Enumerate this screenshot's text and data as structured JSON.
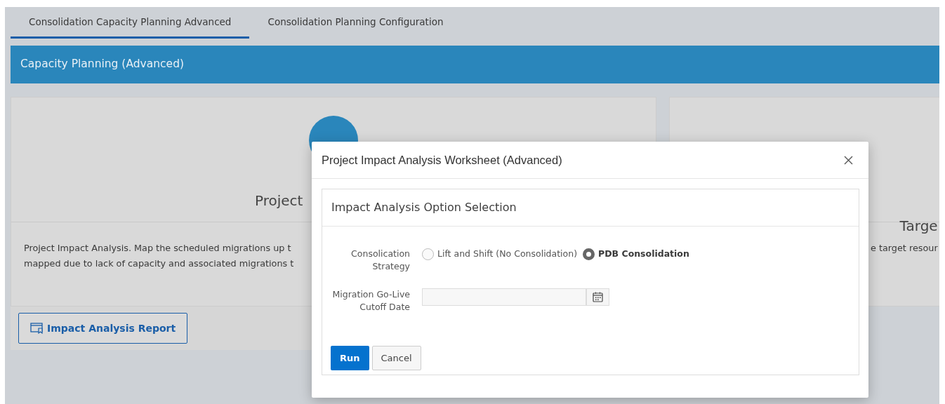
{
  "tabs": [
    {
      "label": "Consolidation Capacity Planning Advanced",
      "selected": true
    },
    {
      "label": "Consolidation Planning Configuration",
      "selected": false
    }
  ],
  "banner": {
    "title": "Capacity Planning (Advanced)"
  },
  "cards": [
    {
      "title": "Project",
      "description_lines": [
        "Project Impact Analysis. Map the scheduled migrations up t",
        "mapped due to lack of capacity and associated migrations t"
      ],
      "button": "Impact Analysis Report"
    },
    {
      "title": "Targe",
      "description_lines": [
        "e target resour"
      ]
    }
  ],
  "dialog": {
    "title": "Project Impact Analysis Worksheet (Advanced)",
    "region_title": "Impact Analysis Option Selection",
    "fields": [
      {
        "kind": "radio",
        "label": "Consolication Strategy",
        "options": [
          {
            "label": "Lift and Shift (No Consolidation)",
            "selected": false
          },
          {
            "label": "PDB Consolidation",
            "selected": true
          }
        ]
      },
      {
        "kind": "date",
        "label": "Migration Go-Live Cutoff Date"
      }
    ],
    "buttons": [
      {
        "label": "Run",
        "kind": "primary"
      },
      {
        "label": "Cancel",
        "kind": "secondary"
      }
    ]
  }
}
